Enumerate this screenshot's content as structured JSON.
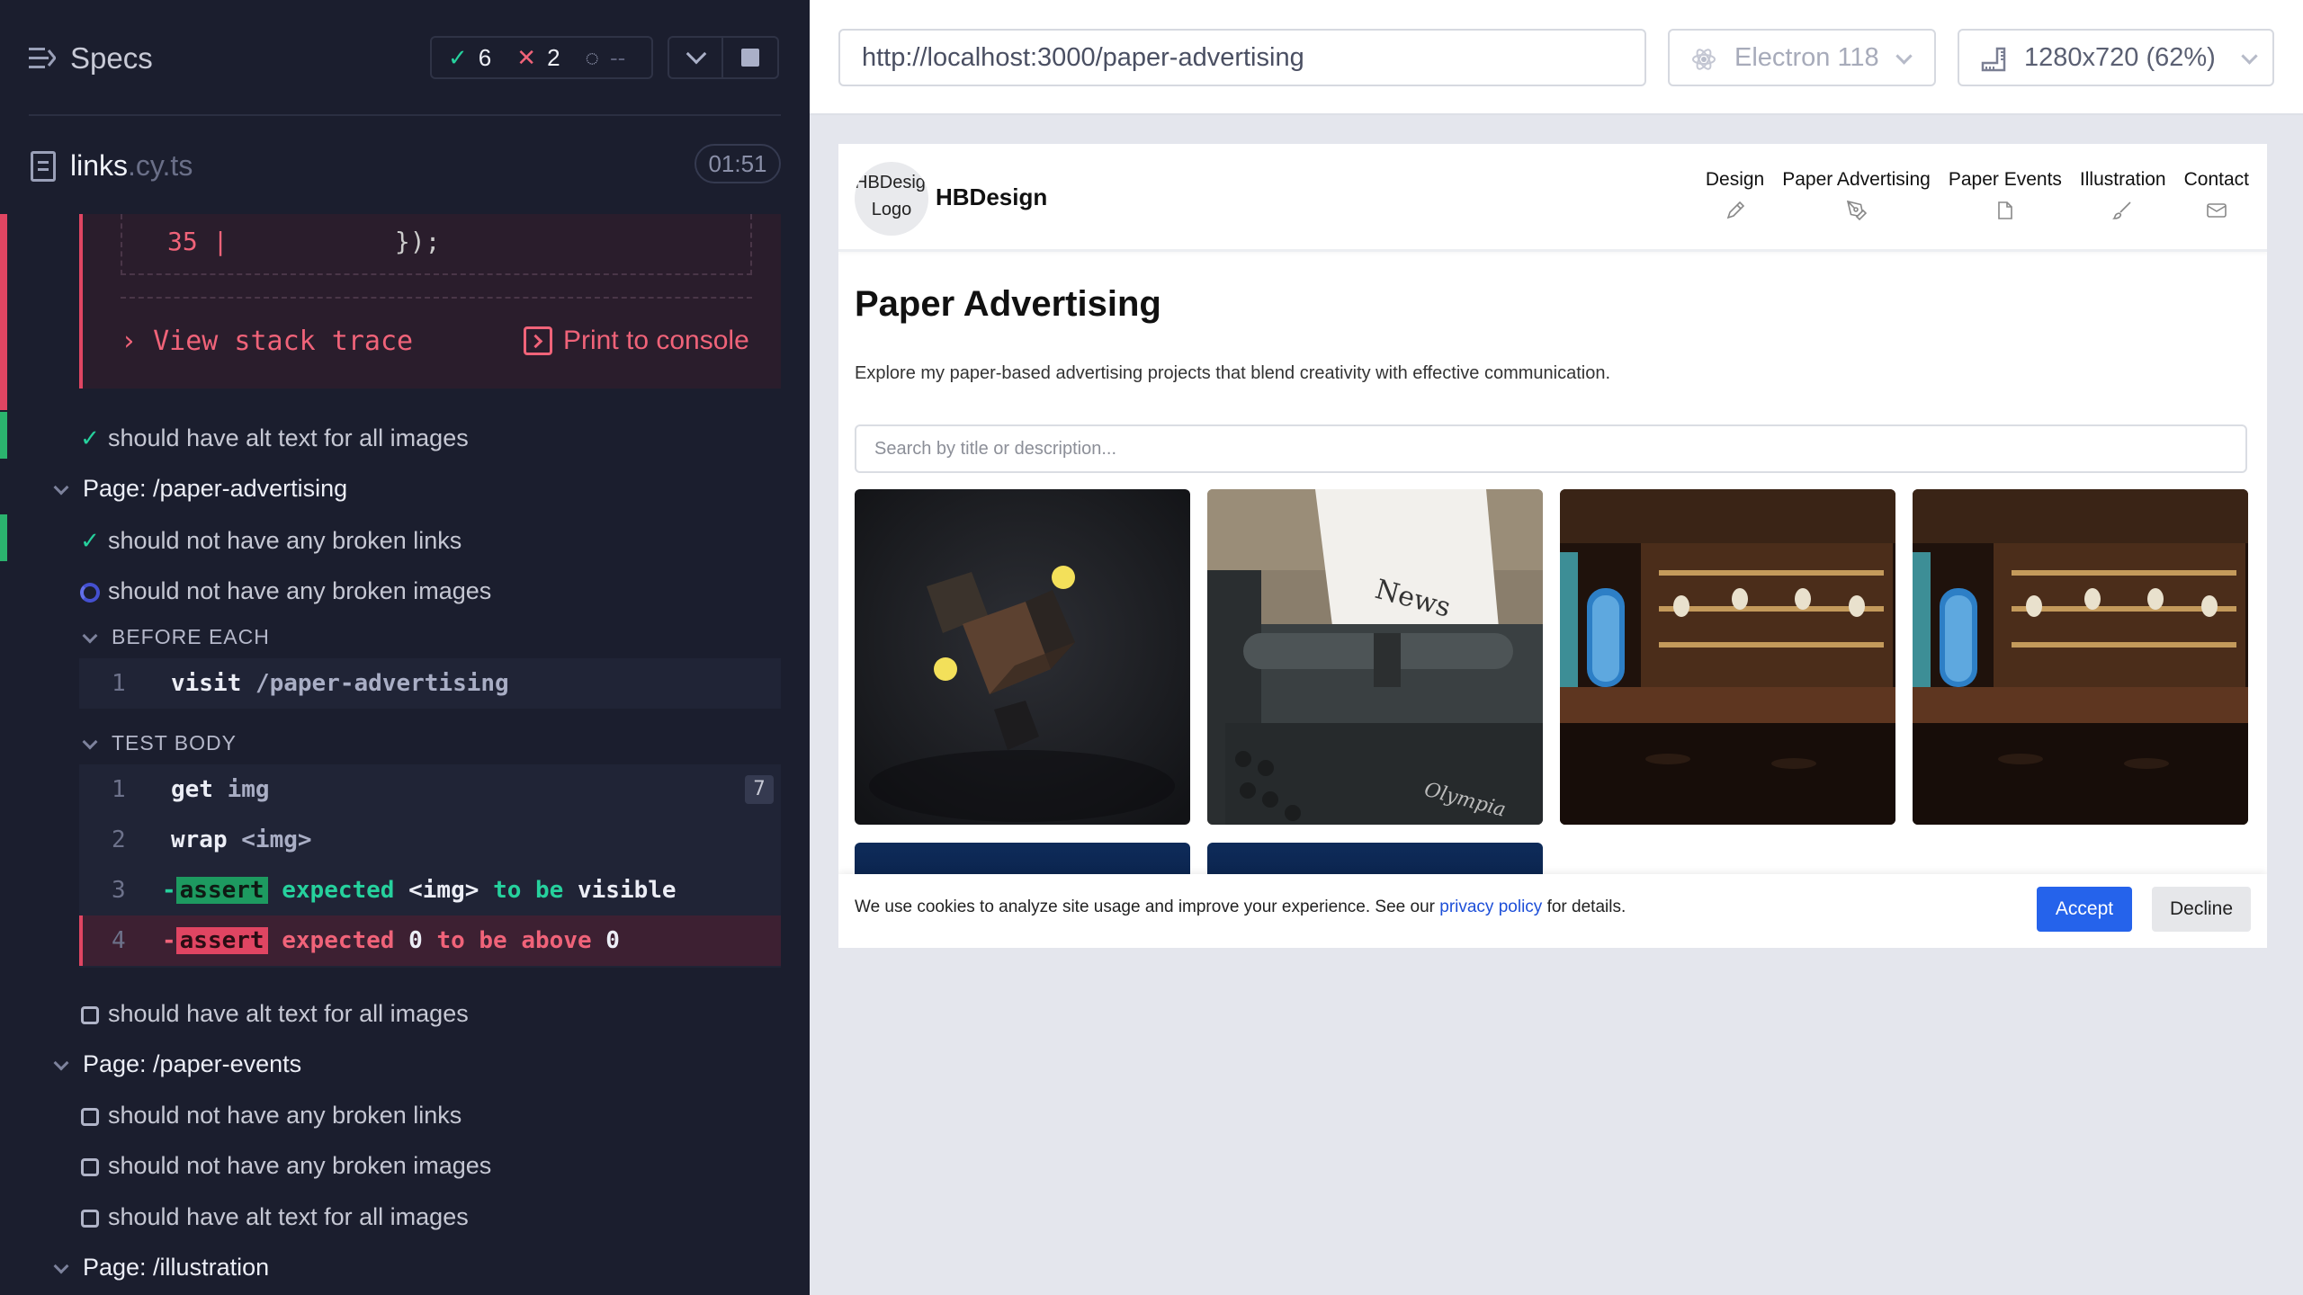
{
  "reporter": {
    "header": {
      "title": "Specs"
    },
    "stats": {
      "passed": "6",
      "failed": "2",
      "pending": "--"
    },
    "file": {
      "name": "links",
      "ext": ".cy.ts",
      "duration": "01:51"
    },
    "error": {
      "code_line_num": "35",
      "code_line_bar": "|",
      "code_line_text": "});",
      "stack_label": "View stack trace",
      "print_label": "Print to console"
    },
    "rows": {
      "test_alt_1": "should have alt text for all images",
      "suite_paper_adv": "Page: /paper-advertising",
      "test_links_2": "should not have any broken links",
      "test_images_2": "should not have any broken images",
      "before_each": "BEFORE EACH",
      "test_body": "TEST BODY",
      "test_alt_2": "should have alt text for all images",
      "suite_paper_events": "Page: /paper-events",
      "test_links_3": "should not have any broken links",
      "test_images_3": "should not have any broken images",
      "test_alt_3": "should have alt text for all images",
      "suite_illustration": "Page: /illustration"
    },
    "before_cmds": [
      {
        "num": "1",
        "name": "visit",
        "msg": "/paper-advertising"
      }
    ],
    "body_cmds": [
      {
        "num": "1",
        "name": "get",
        "msg": "img",
        "badge": "7"
      },
      {
        "num": "2",
        "name": "wrap",
        "msg": "<img>"
      },
      {
        "num": "3",
        "prefix": "-",
        "name": "assert",
        "w1": "expected",
        "w2": "<img>",
        "w3": "to be",
        "w4": "visible"
      },
      {
        "num": "4",
        "prefix": "-",
        "name": "assert",
        "w1": "expected",
        "w2": "0",
        "w3": "to be above",
        "w4": "0"
      }
    ]
  },
  "aut": {
    "url": "http://localhost:3000/paper-advertising",
    "browser": "Electron 118",
    "viewport": "1280x720",
    "viewport_scale": "(62%)"
  },
  "site": {
    "logo_alt": "HBDesign Logo",
    "brand": "HBDesign",
    "nav": [
      {
        "label": "Design",
        "icon": "pencil-icon"
      },
      {
        "label": "Paper Advertising",
        "icon": "pen-tool-icon"
      },
      {
        "label": "Paper Events",
        "icon": "file-icon"
      },
      {
        "label": "Illustration",
        "icon": "brush-icon"
      },
      {
        "label": "Contact",
        "icon": "mail-icon"
      }
    ],
    "title": "Paper Advertising",
    "description": "Explore my paper-based advertising projects that blend creativity with effective communication.",
    "search_placeholder": "Search by title or description...",
    "cookie": {
      "text_before": "We use cookies to analyze site usage and improve your experience. See our ",
      "link": "privacy policy",
      "text_after": " for details.",
      "accept": "Accept",
      "decline": "Decline"
    },
    "cards": [
      {
        "icon": "floating-cubes-image"
      },
      {
        "icon": "typewriter-news-image"
      },
      {
        "icon": "bar-interior-image"
      },
      {
        "icon": "bar-interior-image"
      }
    ]
  },
  "colors": {
    "reporter_bg": "#1b1e2e",
    "pass": "#26d19d",
    "fail": "#f06379",
    "accent_blue": "#2563eb"
  }
}
